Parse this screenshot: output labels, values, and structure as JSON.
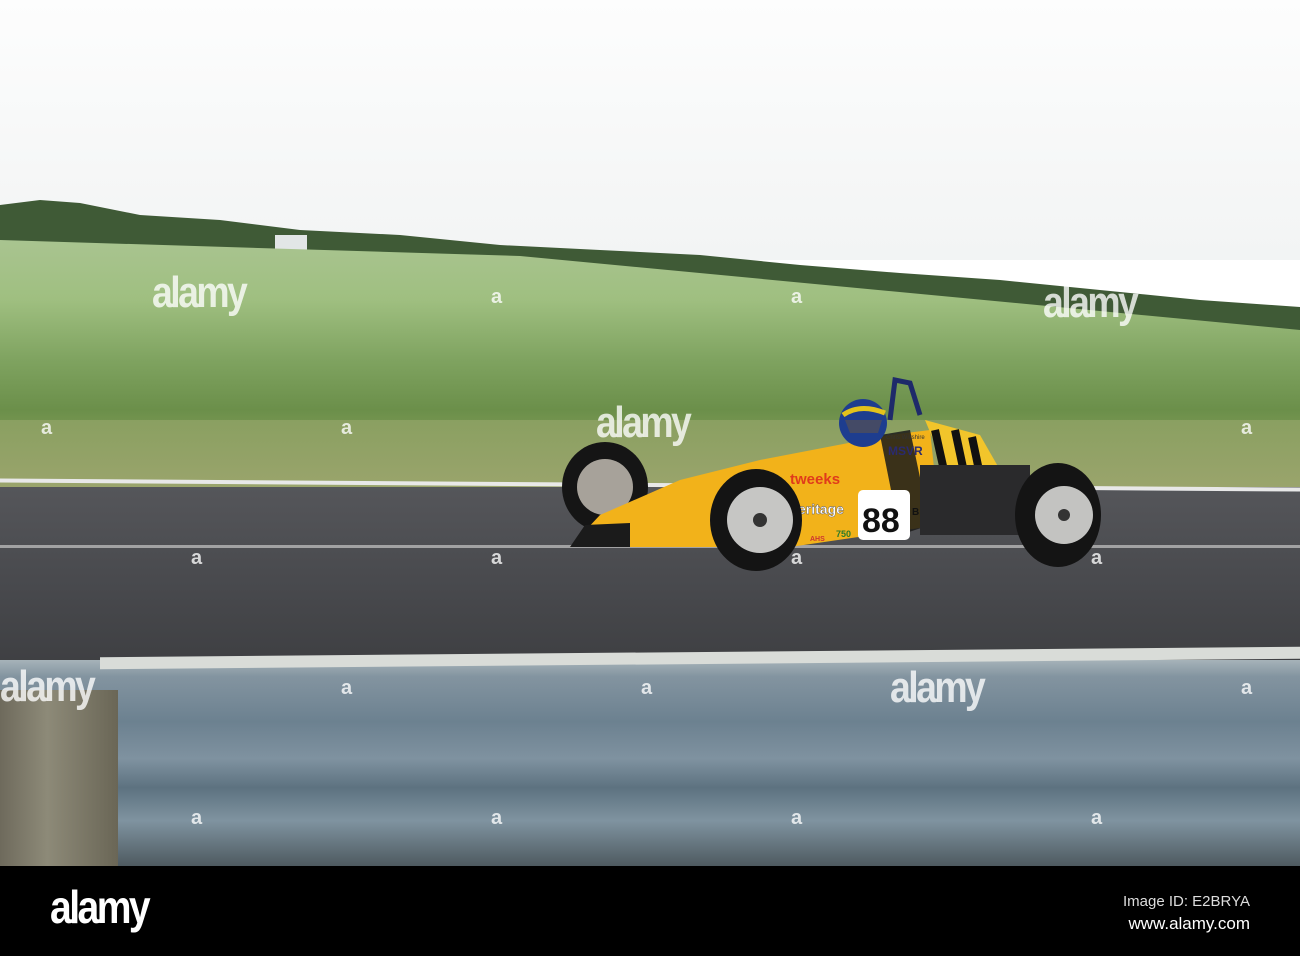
{
  "watermark": {
    "brand": "alamy",
    "mark": "a"
  },
  "footer": {
    "logo": "alamy",
    "image_id": "Image ID: E2BRYA",
    "website": "www.alamy.com"
  },
  "car": {
    "number": "88",
    "class_letter": "B",
    "sponsors": [
      "tweeks",
      "eritage",
      "MSVR",
      "750",
      "AHS"
    ],
    "driver_name": "Chris Wiltshire"
  },
  "colors": {
    "car_body": "#f2b21a",
    "road": "#4a4b4f",
    "rail": "#7a8d9a",
    "grass": "#8fb070"
  }
}
